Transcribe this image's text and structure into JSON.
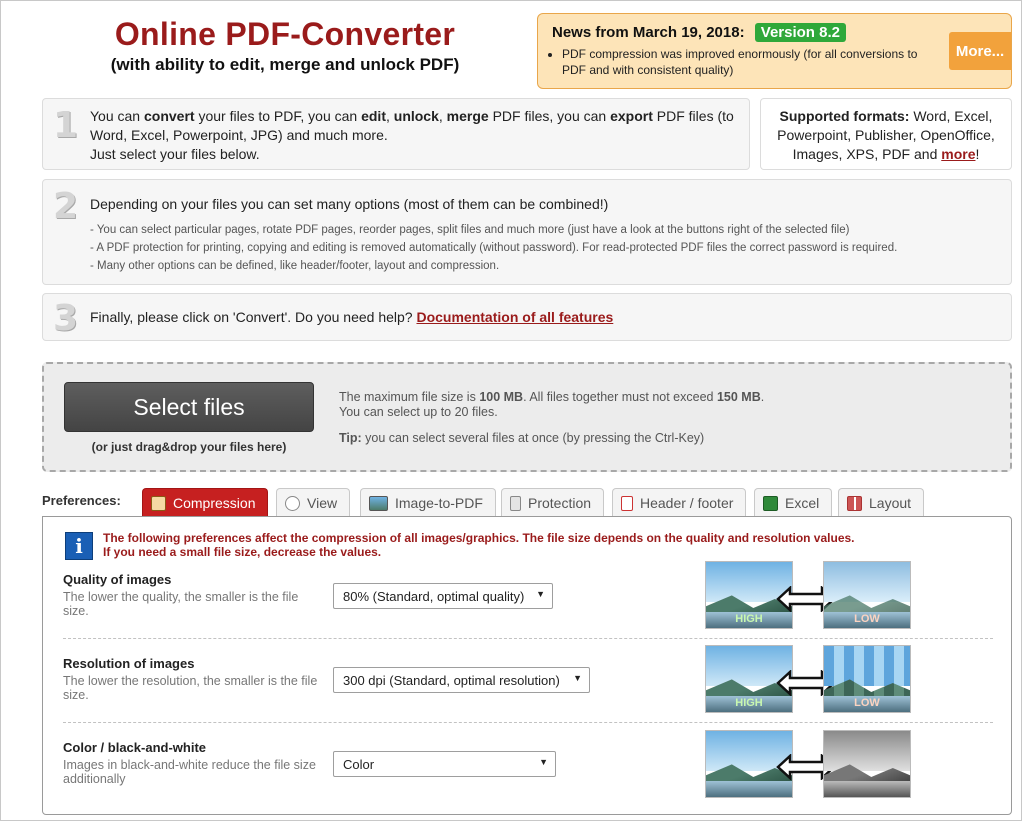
{
  "header": {
    "title": "Online PDF-Converter",
    "subtitle": "(with ability to edit, merge and unlock PDF)"
  },
  "news": {
    "heading": "News from March 19, 2018:",
    "version": "Version 8.2",
    "item": "PDF compression was improved enormously (for all conversions to PDF and with consistent quality)",
    "more_label": "More..."
  },
  "step1": {
    "number": "1",
    "parts": [
      "You can ",
      "convert",
      " your files to PDF, you can ",
      "edit",
      ", ",
      "unlock",
      ", ",
      "merge",
      " PDF files, you can ",
      "export",
      " PDF files (to Word, Excel, Powerpoint, JPG) and much more."
    ],
    "line2": "Just select your files below."
  },
  "formats": {
    "label": "Supported formats:",
    "list": " Word, Excel, Powerpoint, Publisher, OpenOffice, Images, XPS, PDF and ",
    "more_link": "more",
    "end": "!"
  },
  "step2": {
    "number": "2",
    "text": "Depending on your files you can set many options (most of them can be combined!)",
    "bullets": [
      "- You can select particular pages, rotate PDF pages, reorder pages, split files and much more (just have a look at the buttons right of the selected file)",
      "- A PDF protection for printing, copying and editing is removed automatically (without password). For read-protected PDF files the correct password is required.",
      "- Many other options can be defined, like header/footer, layout and compression."
    ]
  },
  "step3": {
    "number": "3",
    "text": "Finally, please click on 'Convert'. Do you need help? ",
    "link": "Documentation of all features"
  },
  "upload": {
    "button_label": "Select files",
    "drag_hint": "(or just drag&drop your files here)",
    "size_a": "The maximum file size is ",
    "size_b": "100 MB",
    "size_c": ". All files together must not exceed ",
    "size_d": "150 MB",
    "size_e": ".",
    "limit": "You can select up to 20 files.",
    "tip_label": "Tip:",
    "tip_text": " you can select several files at once (by pressing the Ctrl-Key)"
  },
  "preferences": {
    "label": "Preferences:",
    "tabs": [
      {
        "label": "Compression",
        "active": true
      },
      {
        "label": "View"
      },
      {
        "label": "Image-to-PDF"
      },
      {
        "label": "Protection"
      },
      {
        "label": "Header / footer"
      },
      {
        "label": "Excel"
      },
      {
        "label": "Layout"
      }
    ],
    "notice_line1": "The following preferences affect the compression of all images/graphics. The file size depends on the quality and resolution values.",
    "notice_line2": "If you need a small file size, decrease the values.",
    "rows": [
      {
        "title": "Quality of images",
        "desc": "The lower the quality, the smaller is the file size.",
        "value": "80% (Standard, optimal quality)",
        "left_label": "HIGH",
        "right_label": "LOW"
      },
      {
        "title": "Resolution of images",
        "desc": "The lower the resolution, the smaller is the file size.",
        "value": "300 dpi (Standard, optimal resolution)",
        "left_label": "HIGH",
        "right_label": "LOW"
      },
      {
        "title": "Color / black-and-white",
        "desc": "Images in black-and-white reduce the file size additionally",
        "value": "Color"
      }
    ]
  }
}
